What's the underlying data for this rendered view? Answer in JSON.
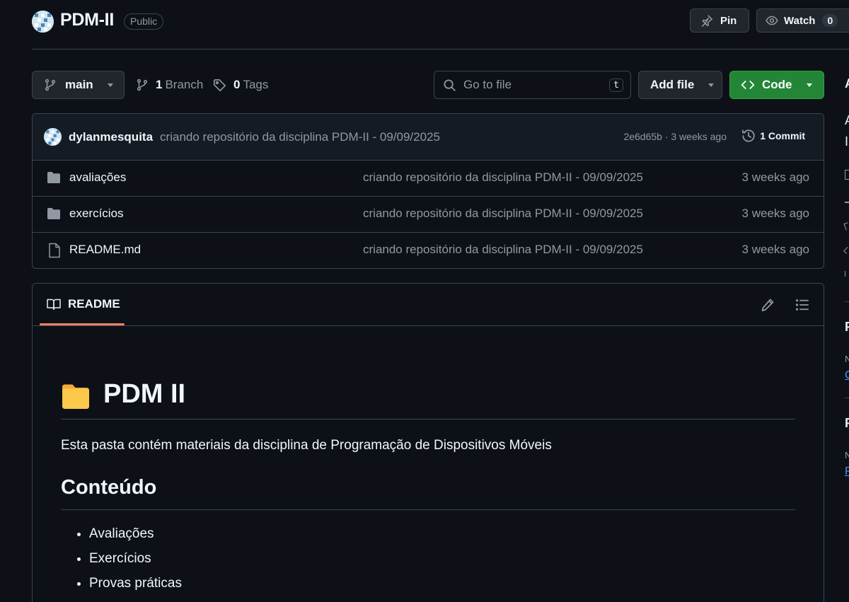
{
  "repo": {
    "name": "PDM-II",
    "visibility": "Public"
  },
  "header_actions": {
    "pin_label": "Pin",
    "watch_label": "Watch",
    "watch_count": "0"
  },
  "toolbar": {
    "branch": "main",
    "branch_count": "1",
    "branch_label": "Branch",
    "tag_count": "0",
    "tag_label": "Tags",
    "search_placeholder": "Go to file",
    "search_shortcut": "t",
    "add_file_label": "Add file",
    "code_label": "Code"
  },
  "latest_commit": {
    "author": "dylanmesquita",
    "message": "criando repositório da disciplina PDM-II - 09/09/2025",
    "meta": "2e6d65b · 3 weeks ago",
    "commit_count_label": "1 Commit"
  },
  "files": [
    {
      "name": "avaliações",
      "type": "folder",
      "commit": "criando repositório da disciplina PDM-II - 09/09/2025",
      "time": "3 weeks ago"
    },
    {
      "name": "exercícios",
      "type": "folder",
      "commit": "criando repositório da disciplina PDM-II - 09/09/2025",
      "time": "3 weeks ago"
    },
    {
      "name": "README.md",
      "type": "file",
      "commit": "criando repositório da disciplina PDM-II - 09/09/2025",
      "time": "3 weeks ago"
    }
  ],
  "readme": {
    "tab_label": "README",
    "title": "PDM II",
    "description": "Esta pasta contém materiais da disciplina de Programação de Dispositivos Móveis",
    "section_title": "Conteúdo",
    "items": [
      "Avaliações",
      "Exercícios",
      "Provas práticas"
    ]
  },
  "sidebar_clipped": {
    "letters": [
      "A",
      "A",
      "I",
      "F",
      "N",
      "C",
      "F",
      "N",
      "P"
    ]
  },
  "colors": {
    "background": "#0d1117",
    "border": "#3d444d",
    "code_button": "#238636",
    "tab_underline": "#f78166",
    "folder_icon": "#9198a1"
  }
}
